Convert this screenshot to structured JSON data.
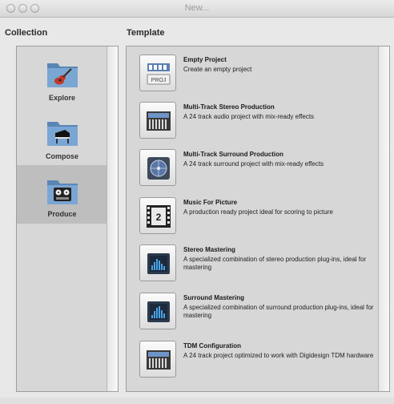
{
  "window": {
    "title": "New..."
  },
  "collection": {
    "header": "Collection",
    "items": [
      {
        "label": "Explore",
        "icon": "guitar-folder-icon",
        "selected": false
      },
      {
        "label": "Compose",
        "icon": "piano-folder-icon",
        "selected": false
      },
      {
        "label": "Produce",
        "icon": "tape-deck-folder-icon",
        "selected": true
      }
    ]
  },
  "templates": {
    "header": "Template",
    "items": [
      {
        "title": "Empty Project",
        "description": "Create an empty project",
        "icon": "empty-project-icon",
        "icon_text": "PROJ"
      },
      {
        "title": "Multi-Track Stereo Production",
        "description": "A 24 track audio project with mix-ready effects",
        "icon": "stereo-production-icon"
      },
      {
        "title": "Multi-Track Surround Production",
        "description": "A 24 track surround project with mix-ready effects",
        "icon": "surround-production-icon"
      },
      {
        "title": "Music For Picture",
        "description": "A production ready project ideal for scoring to picture",
        "icon": "film-strip-icon",
        "icon_text": "2"
      },
      {
        "title": "Stereo Mastering",
        "description": "A specialized combination of stereo production plug-ins, ideal for mastering",
        "icon": "stereo-mastering-icon"
      },
      {
        "title": "Surround Mastering",
        "description": "A specialized combination of surround production plug-ins, ideal for mastering",
        "icon": "surround-mastering-icon"
      },
      {
        "title": "TDM Configuration",
        "description": "A 24 track project optimized to work with Digidesign TDM hardware",
        "icon": "tdm-configuration-icon"
      }
    ]
  },
  "colors": {
    "folder_blue": "#6f9cc9",
    "panel_gray": "#d7d7d7",
    "selected_gray": "#bebebe"
  }
}
